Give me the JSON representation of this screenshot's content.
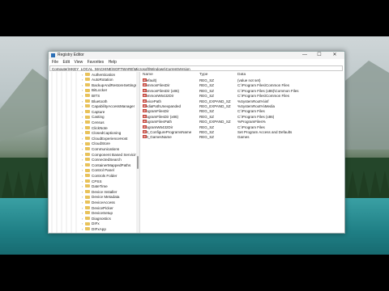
{
  "window": {
    "title": "Registry Editor",
    "controls": {
      "minimize": "—",
      "maximize": "☐",
      "close": "✕"
    }
  },
  "menu": [
    "File",
    "Edit",
    "View",
    "Favorites",
    "Help"
  ],
  "address": "Computer\\HKEY_LOCAL_MACHINE\\SOFTWARE\\Microsoft\\Windows\\CurrentVersion",
  "tree": [
    "Authentication",
    "AutoRotation",
    "BackupAndRestoreSettings",
    "BitLocker",
    "BITS",
    "Bluetooth",
    "CapabilityAccessManager",
    "Capture",
    "Casting",
    "Census",
    "ClickNote",
    "ClosedCaptioning",
    "CloudExperienceHost",
    "CloudStore",
    "Communications",
    "Component Based Servicing",
    "ConnectedSearch",
    "ContainerMappedPaths",
    "Control Panel",
    "Controls Folder",
    "CPSS",
    "DateTime",
    "Device Installer",
    "Device Metadata",
    "DeviceAccess",
    "DevicePicker",
    "DeviceSetup",
    "Diagnostics",
    "DIFx",
    "DIFxApp"
  ],
  "list": {
    "headers": {
      "name": "Name",
      "type": "Type",
      "data": "Data"
    },
    "rows": [
      {
        "icon": "ab",
        "name": "(Default)",
        "type": "REG_SZ",
        "data": "(value not set)"
      },
      {
        "icon": "ab",
        "name": "CommonFilesDir",
        "type": "REG_SZ",
        "data": "C:\\Program Files\\Common Files"
      },
      {
        "icon": "ab",
        "name": "CommonFilesDir (x86)",
        "type": "REG_SZ",
        "data": "C:\\Program Files (x86)\\Common Files"
      },
      {
        "icon": "ab",
        "name": "CommonW6432Dir",
        "type": "REG_SZ",
        "data": "C:\\Program Files\\Common Files"
      },
      {
        "icon": "ab",
        "name": "DevicePath",
        "type": "REG_EXPAND_SZ",
        "data": "%SystemRoot%\\inf"
      },
      {
        "icon": "ab",
        "name": "MediaPathUnexpanded",
        "type": "REG_EXPAND_SZ",
        "data": "%SystemRoot%\\Media"
      },
      {
        "icon": "ab",
        "name": "ProgramFilesDir",
        "type": "REG_SZ",
        "data": "C:\\Program Files"
      },
      {
        "icon": "ab",
        "name": "ProgramFilesDir (x86)",
        "type": "REG_SZ",
        "data": "C:\\Program Files (x86)"
      },
      {
        "icon": "ab",
        "name": "ProgramFilesPath",
        "type": "REG_EXPAND_SZ",
        "data": "%ProgramFiles%"
      },
      {
        "icon": "ab",
        "name": "ProgramW6432Dir",
        "type": "REG_SZ",
        "data": "C:\\Program Files"
      },
      {
        "icon": "ab",
        "name": "SM_ConfigureProgramsName",
        "type": "REG_SZ",
        "data": "Set Program Access and Defaults"
      },
      {
        "icon": "ab",
        "name": "SM_GamesName",
        "type": "REG_SZ",
        "data": "Games"
      }
    ]
  },
  "colors": {
    "folder": "#e8c25a",
    "string_icon": "#c4453b",
    "accent": "#2b6fb6"
  }
}
